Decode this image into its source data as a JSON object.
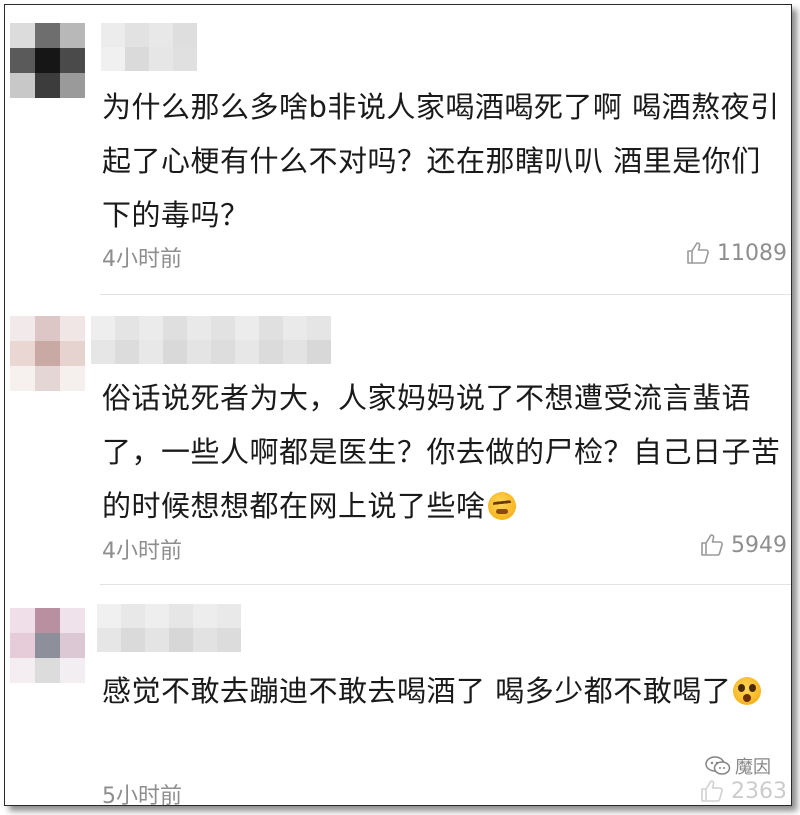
{
  "comments": [
    {
      "text": "为什么那么多啥b非说人家喝酒喝死了啊 喝酒熬夜引起了心梗有什么不对吗？还在那瞎叭叭 酒里是你们下的毒吗？",
      "emoji": "",
      "time": "4小时前",
      "likes": "11089"
    },
    {
      "text": "俗话说死者为大，人家妈妈说了不想遭受流言蜚语了，一些人啊都是医生？你去做的尸检？自己日子苦的时候想想都在网上说了些啥",
      "emoji": "angry-face-emoji",
      "time": "4小时前",
      "likes": "5949"
    },
    {
      "text": "感觉不敢去蹦迪不敢去喝酒了 喝多少都不敢喝了",
      "emoji": "shocked-face-emoji",
      "time": "5小时前",
      "likes": "2363"
    }
  ],
  "icons": {
    "like": "thumbs-up-icon",
    "watermark": "wechat-icon"
  },
  "watermark": {
    "text": "魔因"
  },
  "colors": {
    "text": "#1a1a1a",
    "meta": "#8e8e8e",
    "divider": "#e3e3e3",
    "border": "#2a2a2a"
  }
}
